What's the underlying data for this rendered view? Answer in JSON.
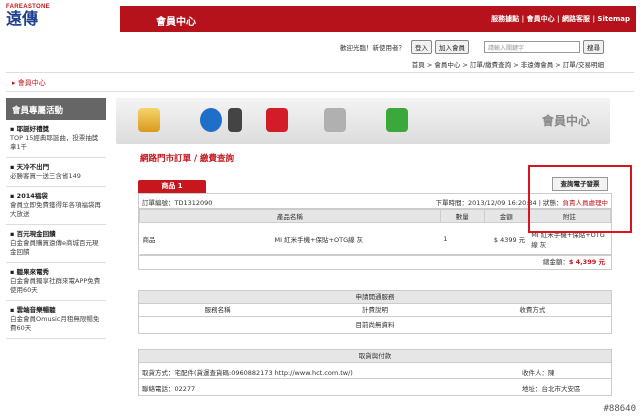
{
  "logo": {
    "en": "FAREASTONE",
    "zh": "遠傳"
  },
  "header": {
    "title": "會員中心",
    "links": "服務據點 | 會員中心 | 網路客服 | Sitemap"
  },
  "toolbar": {
    "welcome": "歡迎光臨！新使用者？",
    "login": "登入",
    "join": "加入會員",
    "search_placeholder": "請輸入關鍵字",
    "search": "搜尋"
  },
  "breadcrumb": "首頁 > 會員中心 > 訂單/繳費查詢 > 非遠傳會員 > 訂單/交易明細",
  "member_label": "▸ 會員中心",
  "sidebar": {
    "title": "會員專屬活動",
    "items": [
      {
        "title": "▪ 耶誕好禮獎",
        "desc": "TOP 15經典耶誕曲，投票抽獎拿1千"
      },
      {
        "title": "▪ 天冷不出門",
        "desc": "必勝客買一送三含省149"
      },
      {
        "title": "▪ 2014福袋",
        "desc": "會員立即免費獲得年各項福袋再大放送"
      },
      {
        "title": "▪ 百元現金回饋",
        "desc": "白金會員購買遠傳e商城百元現金回饋"
      },
      {
        "title": "▪ 聽果來電秀",
        "desc": "白金會員獨享社群來電APP免費使用60天"
      },
      {
        "title": "▪ 雲端音樂暢聽",
        "desc": "白金會員Omusic月租無限暢免費60天"
      }
    ]
  },
  "banner": {
    "title": "會員中心"
  },
  "section_title": "網路門市訂單 / 繳費查詢",
  "query_button": "查詢電子發票",
  "tab": "商品 1",
  "order": {
    "number_label": "訂單編號：TD1312090",
    "time_label": "下單時間：2013/12/09 16:20:34 | 狀態：",
    "status": "負責人員處理中"
  },
  "table": {
    "headers": [
      "產品名稱",
      "數量",
      "金額",
      "附註"
    ],
    "row": {
      "type": "商品",
      "name": "MI 紅米手機+保貼+OTG線 灰",
      "qty": "1",
      "price": "$ 4399 元",
      "note": "MI 紅米手機+保貼+OTG線 灰"
    }
  },
  "total": {
    "label": "總金額：",
    "amount": "$ 4,399 元"
  },
  "service": {
    "title": "申請開通服務",
    "cols": [
      "服務名稱",
      "計費說明",
      "收費方式"
    ],
    "empty": "目前尚無資料"
  },
  "payment": {
    "title": "取貨與付款",
    "delivery": "取貨方式：宅配件(貨運查貨碼:0960882173 http://www.hct.com.tw/)",
    "receiver": "收件人：陳",
    "phone": "聯絡電話：02277",
    "address": "地址：台北市大安區"
  },
  "watermark": "#88640"
}
